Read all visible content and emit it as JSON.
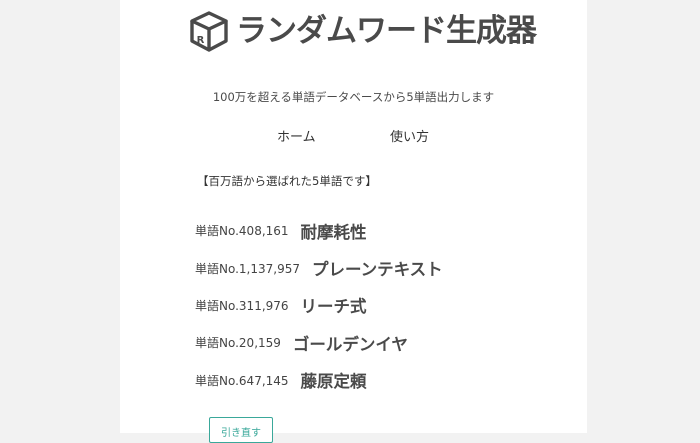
{
  "site": {
    "title": "ランダムワード生成器",
    "logo_letter": "R",
    "tagline": "100万を超える単語データベースから5単語出力します"
  },
  "nav": {
    "items": [
      {
        "label": "ホーム"
      },
      {
        "label": "使い方"
      }
    ]
  },
  "result": {
    "notice": "【百万語から選ばれた5単語です】",
    "words": [
      {
        "number": "単語No.408,161",
        "word": "耐摩耗性"
      },
      {
        "number": "単語No.1,137,957",
        "word": "プレーンテキスト"
      },
      {
        "number": "単語No.311,976",
        "word": "リーチ式"
      },
      {
        "number": "単語No.20,159",
        "word": "ゴールデンイヤ"
      },
      {
        "number": "単語No.647,145",
        "word": "藤原定頼"
      }
    ],
    "redraw_label": "引き直す"
  },
  "colors": {
    "background": "#f2f2f2",
    "panel": "#ffffff",
    "text": "#4a4a4a",
    "accent": "#3aa89a"
  },
  "icons": {
    "logo": "box-icon"
  }
}
